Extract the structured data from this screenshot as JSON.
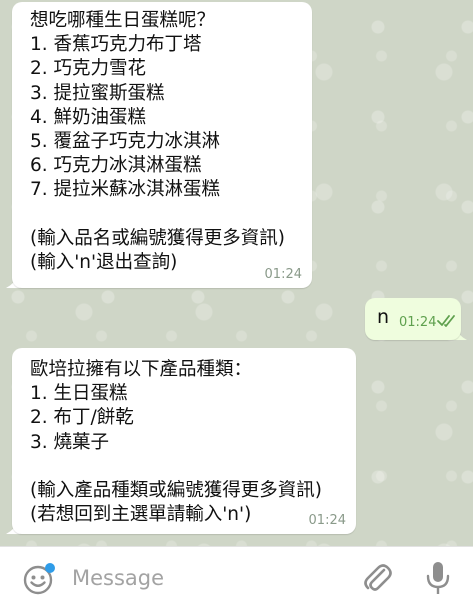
{
  "messages": [
    {
      "direction": "incoming",
      "lines": [
        "想吃哪種生日蛋糕呢？",
        "1. 香蕉巧克力布丁塔",
        "2. 巧克力雪花",
        "3. 提拉蜜斯蛋糕",
        "4. 鮮奶油蛋糕",
        "5. 覆盆子巧克力冰淇淋",
        "6. 巧克力冰淇淋蛋糕",
        "7. 提拉米蘇冰淇淋蛋糕",
        "",
        "(輸入品名或編號獲得更多資訊)",
        "(輸入'n'退出查詢)"
      ],
      "time": "01:24"
    },
    {
      "direction": "outgoing",
      "text": "n",
      "time": "01:24",
      "status": "read"
    },
    {
      "direction": "incoming",
      "lines": [
        "歐培拉擁有以下產品種類：",
        "1. 生日蛋糕",
        "2. 布丁/餅乾",
        "3. 燒菓子",
        "",
        "(輸入產品種類或編號獲得更多資訊)",
        "(若想回到主選單請輸入'n')"
      ],
      "time": "01:24"
    }
  ],
  "input_bar": {
    "placeholder": "Message",
    "icons": {
      "emoji": "emoji-smiley-icon",
      "attach": "paperclip-icon",
      "mic": "microphone-icon"
    }
  },
  "colors": {
    "incoming_bubble": "#ffffff",
    "outgoing_bubble": "#effdde",
    "read_check": "#5fa04e",
    "emoji_dot": "#2f9ce8"
  }
}
